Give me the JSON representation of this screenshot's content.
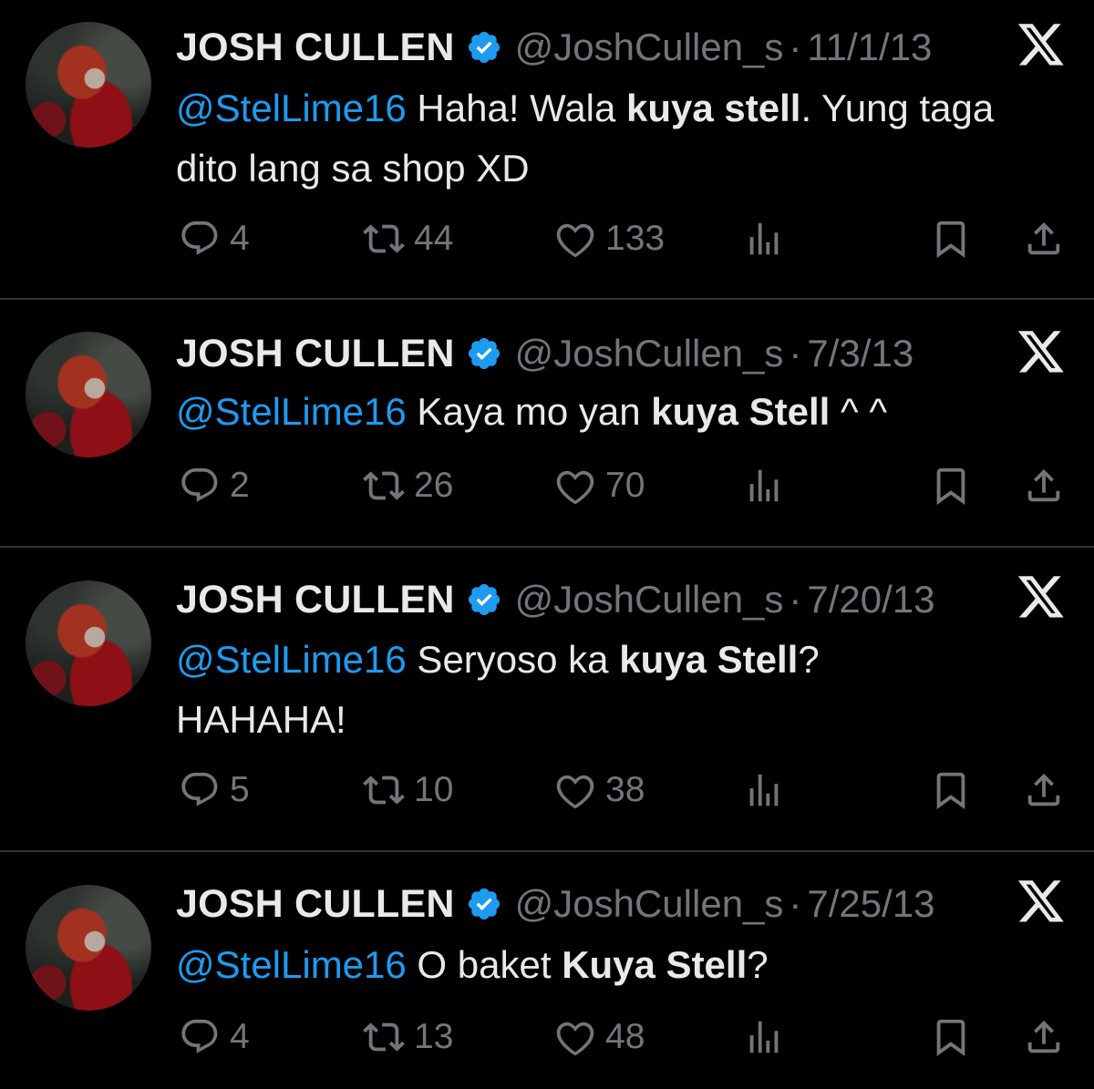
{
  "tweets": [
    {
      "name": "JOSH CULLEN",
      "handle": "@JoshCullen_s",
      "dot": "·",
      "date": "11/1/13",
      "mention": "@StelLime16",
      "text1": " Haha! Wala ",
      "bold": "kuya stell",
      "text2": ". Yung taga dito lang sa shop XD",
      "replies": "4",
      "retweets": "44",
      "likes": "133"
    },
    {
      "name": "JOSH CULLEN",
      "handle": "@JoshCullen_s",
      "dot": "·",
      "date": "7/3/13",
      "mention": "@StelLime16",
      "text1": " Kaya mo yan ",
      "bold": "kuya Stell",
      "text2": " ^ ^",
      "replies": "2",
      "retweets": "26",
      "likes": "70"
    },
    {
      "name": "JOSH CULLEN",
      "handle": "@JoshCullen_s",
      "dot": "·",
      "date": "7/20/13",
      "mention": "@StelLime16",
      "text1": " Seryoso ka ",
      "bold": "kuya Stell",
      "text2": "? HAHAHA!",
      "replies": "5",
      "retweets": "10",
      "likes": "38"
    },
    {
      "name": "JOSH CULLEN",
      "handle": "@JoshCullen_s",
      "dot": "·",
      "date": "7/25/13",
      "mention": "@StelLime16",
      "text1": " O baket ",
      "bold": "Kuya Stell",
      "text2": "?",
      "replies": "4",
      "retweets": "13",
      "likes": "48"
    }
  ],
  "colors": {
    "background": "#000000",
    "text": "#e7e9ea",
    "muted": "#71767b",
    "mention": "#1d9bf0",
    "verified": "#1d9bf0",
    "divider": "#2f3336"
  },
  "icons": [
    "verified-badge-icon",
    "x-logo-icon",
    "reply-icon",
    "retweet-icon",
    "like-icon",
    "views-icon",
    "bookmark-icon",
    "share-icon"
  ]
}
